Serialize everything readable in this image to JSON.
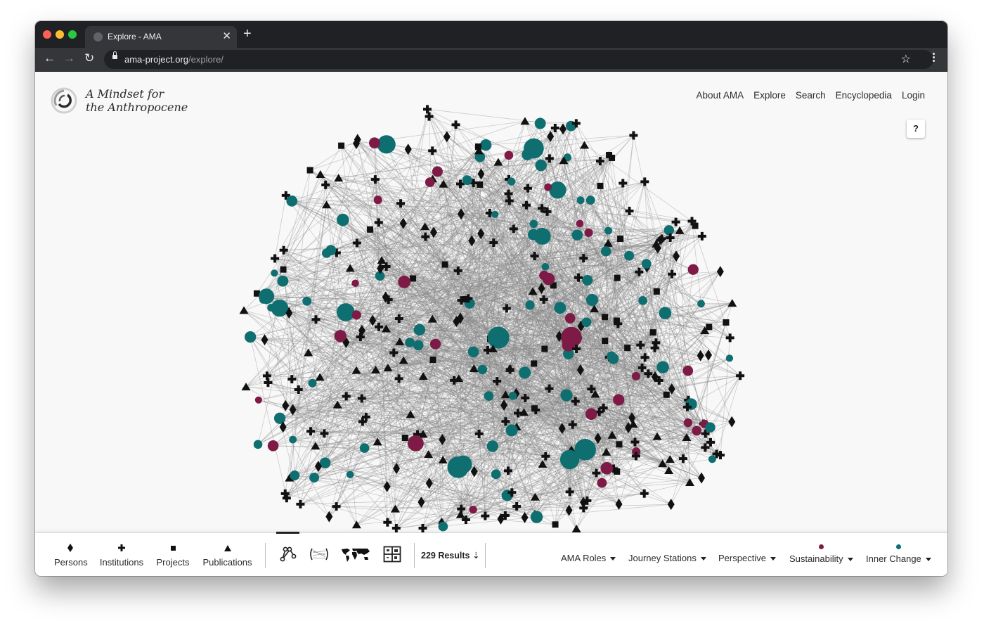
{
  "browser": {
    "tab_title": "Explore - AMA",
    "url_host": "ama-project.org",
    "url_path": "/explore/"
  },
  "site": {
    "brand_line1": "A Mindset for",
    "brand_line2": "the Anthropocene",
    "nav": [
      "About AMA",
      "Explore",
      "Search",
      "Encyclopedia",
      "Login"
    ],
    "help_label": "?"
  },
  "filters": {
    "types": [
      {
        "label": "Persons",
        "icon": "diamond-icon"
      },
      {
        "label": "Institutions",
        "icon": "cross-icon"
      },
      {
        "label": "Projects",
        "icon": "square-icon"
      },
      {
        "label": "Publications",
        "icon": "triangle-icon"
      }
    ],
    "views": [
      {
        "name": "network-view",
        "icon": "network-graph-icon",
        "active": true
      },
      {
        "name": "arc-view",
        "icon": "arc-diagram-icon",
        "active": false
      },
      {
        "name": "map-view",
        "icon": "world-map-icon",
        "active": false
      },
      {
        "name": "grid-view",
        "icon": "grid-icon",
        "active": false
      }
    ],
    "results_label": "229 Results",
    "sort_icon": "sort-down-icon",
    "dropdowns": [
      {
        "label": "AMA Roles",
        "dot": null
      },
      {
        "label": "Journey Stations",
        "dot": null
      },
      {
        "label": "Perspective",
        "dot": null
      },
      {
        "label": "Sustainability",
        "dot": "#7d1a45"
      },
      {
        "label": "Inner Change",
        "dot": "#0e6e70"
      }
    ]
  },
  "colors": {
    "sustainability": "#7d1a45",
    "inner_change": "#0e6e70",
    "node_black": "#111111",
    "edge": "#888888"
  },
  "graph": {
    "visible_node_counts": {
      "inner_change_circles": 85,
      "sustainability_circles": 33,
      "institutions_crosses": 130,
      "persons_diamonds": 60,
      "publications_triangles": 65,
      "projects_squares": 35
    }
  }
}
